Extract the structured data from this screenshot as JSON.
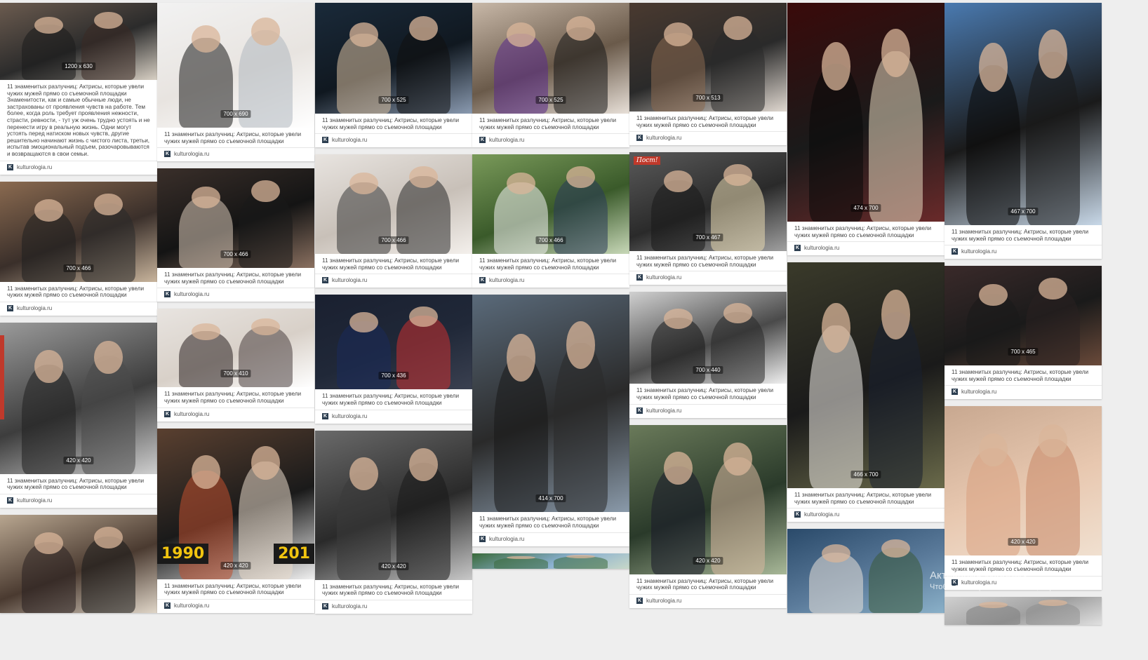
{
  "caption_text": "11 знаменитых разлучниц: Актрисы, которые увели чужих мужей прямо со съемочной площадки",
  "caption_long": "11 знаменитых разлучниц: Актрисы, которые увели чужих мужей прямо со съемочной площадки Знаменитости, как и самые обычные люди, не застрахованы от проявления чувств на работе. Тем более, когда роль требует проявления нежности, страсти, ревности, - тут уж очень трудно устоять и не перенести игру в реальную жизнь. Одни могут устоять перед натиском новых чувств, другие решительно начинают жизнь с чистого листа, третьи, испытав эмоциональный подъем, разочаровываются и возвращаются в свои семьи.",
  "source": "kulturologia.ru",
  "badge_post": "Пост!",
  "year_1990": "1990",
  "year_201": "201",
  "watermark": {
    "line1": "Активация Windows",
    "line2": "Чтобы активировать Windows, перей"
  },
  "columns": [
    {
      "cards": [
        {
          "dims": "1200 x 630",
          "h": 110,
          "caption": "long",
          "colors": [
            "#6b5b4f",
            "#2b2b2b",
            "#d8d0c4"
          ],
          "figs": [
            "#1c1c1c",
            "#3a2a24"
          ]
        },
        {
          "dims": "700 x 466",
          "h": 143,
          "caption": "short",
          "colors": [
            "#8a6a50",
            "#3a2f2a",
            "#c8b49c"
          ],
          "figs": [
            "#1f1f1f",
            "#2a2a2a"
          ]
        },
        {
          "dims": "420 x 420",
          "h": 216,
          "caption": "short",
          "colors": [
            "#9a9a9a",
            "#3d3d3d",
            "#cfcfcf"
          ],
          "figs": [
            "#202020",
            "#4a4a4a"
          ]
        },
        {
          "dims": "",
          "h": 140,
          "caption": "none",
          "colors": [
            "#b8a690",
            "#4a3a30",
            "#e0d6c8"
          ],
          "figs": [
            "#2a2020",
            "#1a1a1a"
          ]
        }
      ]
    },
    {
      "cards": [
        {
          "dims": "700 x 690",
          "h": 178,
          "caption": "short",
          "colors": [
            "#f2f2f2",
            "#e8e4e0",
            "#ffffff"
          ],
          "figs": [
            "#1a1a1a",
            "#b0b8c0"
          ]
        },
        {
          "dims": "700 x 466",
          "h": 142,
          "caption": "short",
          "colors": [
            "#3a2f2a",
            "#141414",
            "#8a7060"
          ],
          "figs": [
            "#d8c8b8",
            "#1a1a1a"
          ]
        },
        {
          "dims": "700 x 410",
          "h": 112,
          "caption": "short",
          "colors": [
            "#e8e4e0",
            "#d8d0c8",
            "#ffffff"
          ],
          "figs": [
            "#2a2020",
            "#4a4040"
          ]
        },
        {
          "dims": "420 x 420",
          "h": 215,
          "caption": "short",
          "colors": [
            "#5a4030",
            "#1a1a1a",
            "#f0f0f0"
          ],
          "figs": [
            "#c05030",
            "#e8d8c8"
          ],
          "year": true
        }
      ]
    },
    {
      "cards": [
        {
          "dims": "700 x 525",
          "h": 158,
          "caption": "short",
          "colors": [
            "#1a2a3a",
            "#101820",
            "#8a9ab0"
          ],
          "figs": [
            "#d8c0a0",
            "#111111"
          ]
        },
        {
          "dims": "700 x 466",
          "h": 142,
          "caption": "short",
          "colors": [
            "#e8e4e0",
            "#c8c0b8",
            "#f4f0ec"
          ],
          "figs": [
            "#3a3a3a",
            "#2a2a2a"
          ]
        },
        {
          "dims": "700 x 436",
          "h": 135,
          "caption": "short",
          "colors": [
            "#1a2030",
            "#202838",
            "#3a4050"
          ],
          "figs": [
            "#1a2a5a",
            "#c83030"
          ]
        },
        {
          "dims": "420 x 420",
          "h": 213,
          "caption": "short",
          "colors": [
            "#6a6a6a",
            "#2a2a2a",
            "#c8c8c8"
          ],
          "figs": [
            "#3a3a3a",
            "#1a1a1a"
          ]
        }
      ]
    },
    {
      "cards": [
        {
          "dims": "700 x 525",
          "h": 158,
          "caption": "short",
          "colors": [
            "#c8b8a8",
            "#6a5a4a",
            "#e8e0d8"
          ],
          "figs": [
            "#5a2a8a",
            "#1a1a1a"
          ]
        },
        {
          "dims": "700 x 466",
          "h": 142,
          "caption": "short",
          "colors": [
            "#7a9a5a",
            "#3a5a2a",
            "#c8d8b8"
          ],
          "figs": [
            "#f0f0f0",
            "#2a3a5a"
          ]
        },
        {
          "dims": "414 x 700",
          "h": 310,
          "caption": "short",
          "colors": [
            "#5a6a7a",
            "#2a2a2a",
            "#8a9aaa"
          ],
          "figs": [
            "#1a1a1a",
            "#2a2a2a"
          ]
        },
        {
          "dims": "",
          "h": 22,
          "caption": "none",
          "colors": [
            "#3a6a3a",
            "#8ab0d0",
            "#c8d8c8"
          ],
          "figs": [
            "#3a6a3a",
            "#3a6a3a"
          ]
        }
      ]
    },
    {
      "cards": [
        {
          "dims": "700 x 513",
          "h": 155,
          "caption": "short",
          "colors": [
            "#4a3a30",
            "#2a2a2a",
            "#e0d8d0"
          ],
          "figs": [
            "#8a6a50",
            "#2a2a2a"
          ]
        },
        {
          "dims": "700 x 467",
          "h": 141,
          "caption": "short",
          "colors": [
            "#5a5a5a",
            "#2a2a2a",
            "#a0a0a0"
          ],
          "figs": [
            "#1a1a1a",
            "#e8d8b0"
          ],
          "badge": true
        },
        {
          "dims": "700 x 440",
          "h": 131,
          "caption": "short",
          "colors": [
            "#d0d0d0",
            "#4a4a4a",
            "#f0f0f0"
          ],
          "figs": [
            "#1a1a1a",
            "#2a2a2a"
          ]
        },
        {
          "dims": "420 x 420",
          "h": 213,
          "caption": "short",
          "colors": [
            "#6a7a5a",
            "#2a3a2a",
            "#a8b898"
          ],
          "figs": [
            "#1a1a2a",
            "#d8b8a0"
          ]
        }
      ]
    },
    {
      "cards": [
        {
          "dims": "474 x 700",
          "h": 312,
          "caption": "short",
          "colors": [
            "#3a0a0a",
            "#1a1a1a",
            "#6a2a2a"
          ],
          "figs": [
            "#0a0a0a",
            "#e8d8c0"
          ]
        },
        {
          "dims": "466 x 700",
          "h": 322,
          "caption": "short",
          "colors": [
            "#3a3a2a",
            "#1a1a1a",
            "#6a6a4a"
          ],
          "figs": [
            "#f0ece8",
            "#1a2030"
          ]
        },
        {
          "dims": "",
          "h": 120,
          "caption": "none",
          "colors": [
            "#2a4a6a",
            "#5a7a9a",
            "#8ab0c8"
          ],
          "figs": [
            "#e8e0d8",
            "#3a5a3a"
          ]
        }
      ]
    },
    {
      "cards": [
        {
          "dims": "467 x 700",
          "h": 317,
          "caption": "short",
          "colors": [
            "#4a7ab0",
            "#1a1a1a",
            "#c8d8e8"
          ],
          "figs": [
            "#0a0a0a",
            "#1a1a1a"
          ]
        },
        {
          "dims": "700 x 465",
          "h": 142,
          "caption": "short",
          "colors": [
            "#3a2a2a",
            "#1a1a1a",
            "#6a4a3a"
          ],
          "figs": [
            "#1a1a1a",
            "#2a2020"
          ]
        },
        {
          "dims": "420 x 420",
          "h": 213,
          "caption": "short",
          "colors": [
            "#c8a890",
            "#e8c8b0",
            "#f0e0d0"
          ],
          "figs": [
            "#d8a080",
            "#c88868"
          ]
        },
        {
          "dims": "",
          "h": 40,
          "caption": "none",
          "colors": [
            "#d0d0d0",
            "#a0a0a0",
            "#e0e0e0"
          ],
          "figs": [
            "#808080",
            "#909090"
          ]
        }
      ]
    }
  ]
}
